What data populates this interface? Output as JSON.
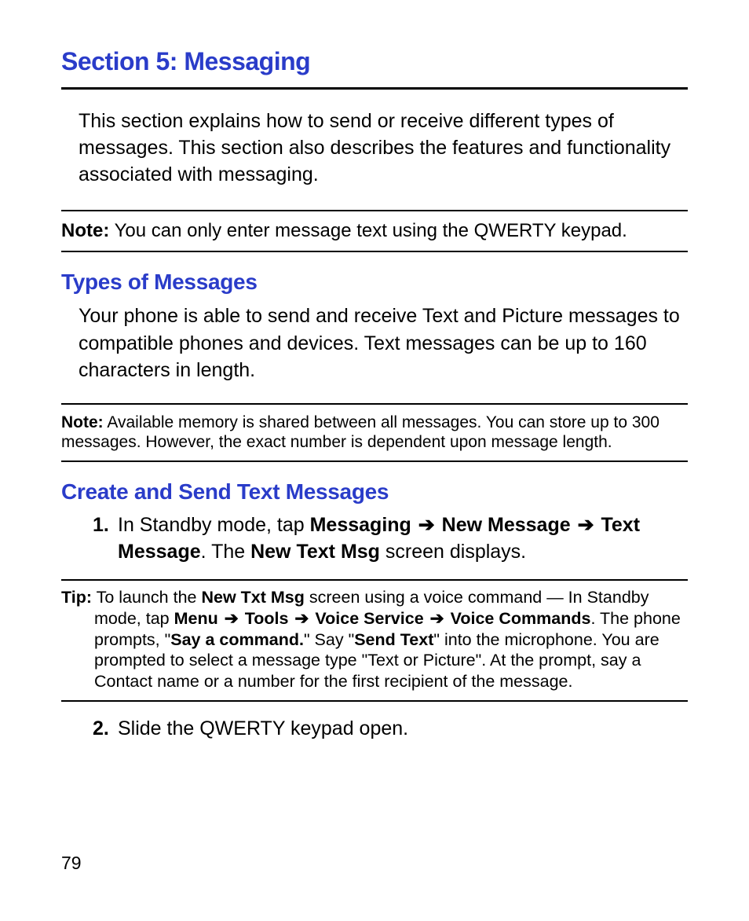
{
  "section_title": "Section 5: Messaging",
  "intro": "This section explains how to send or receive different types of messages. This section also describes the features and functionality associated with messaging.",
  "note1": {
    "label": "Note:",
    "text": " You can only enter message text using the QWERTY keypad."
  },
  "types": {
    "heading": "Types of Messages",
    "body": "Your phone is able to send and receive Text and Picture messages to compatible phones and devices. Text messages can be up to 160 characters in length."
  },
  "note2": {
    "label": "Note:",
    "text": " Available memory is shared between all messages. You can store up to 300 messages. However, the exact number is dependent upon message length."
  },
  "create": {
    "heading": "Create and Send Text Messages",
    "step1": {
      "num": "1.",
      "pre": "In Standby mode, tap ",
      "b1": "Messaging",
      "arrow": " ➔ ",
      "b2": "New Message",
      "b3": "Text Message",
      "mid": ". The ",
      "b4": "New Text Msg",
      "post": " screen displays."
    },
    "tip": {
      "label": "Tip:",
      "t_pre": " To launch the ",
      "t_b1": "New Txt Msg",
      "t_mid1": " screen using a voice command — In Standby mode, tap ",
      "t_b2": "Menu",
      "t_b3": "Tools",
      "t_b4": "Voice Service",
      "t_b5": "Voice Commands",
      "t_mid2": ". The phone prompts, \"",
      "t_b6": "Say a command.",
      "t_mid3": "\" Say \"",
      "t_b7": "Send Text",
      "t_post": "\" into the microphone. You are prompted to select a message type \"Text or Picture\". At the prompt, say a Contact name or a number for the first recipient of the message."
    },
    "step2": {
      "num": "2.",
      "text": "Slide the QWERTY keypad open."
    }
  },
  "page_number": "79"
}
